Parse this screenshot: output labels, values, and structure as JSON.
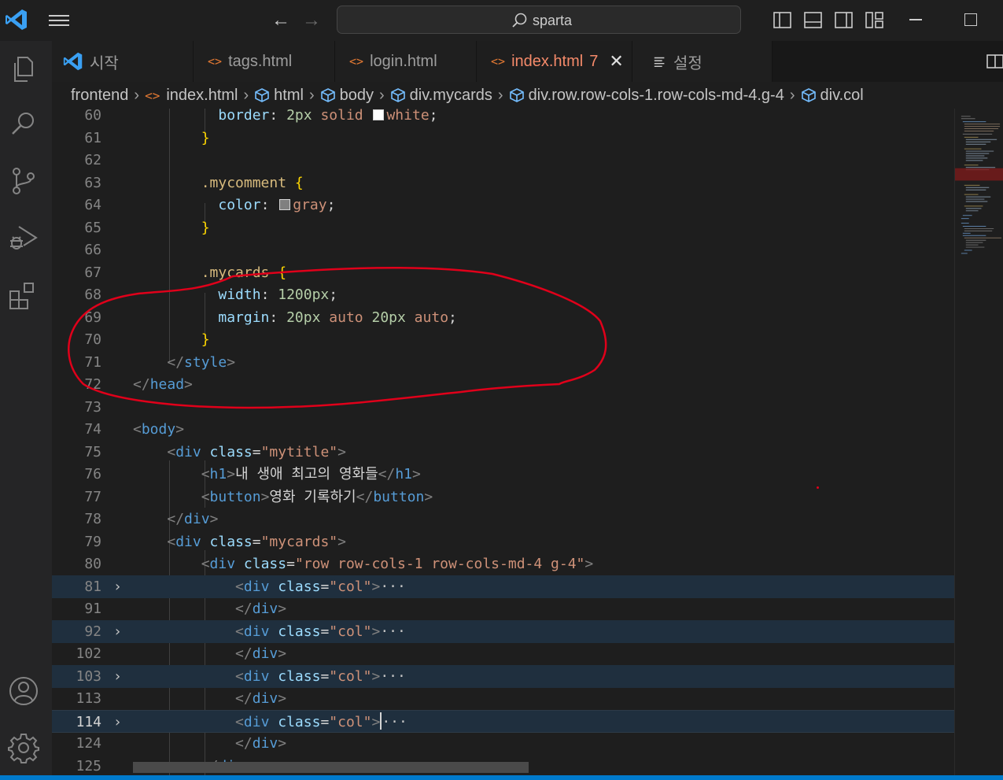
{
  "title_bar": {
    "search_text": "sparta",
    "nav_back": "←",
    "nav_forward": "→"
  },
  "activity_bar": {
    "icons": [
      "explorer-icon",
      "search-icon",
      "source-control-icon",
      "run-debug-icon",
      "extensions-icon",
      "account-icon",
      "settings-gear-icon"
    ]
  },
  "tabs": [
    {
      "label": "시작",
      "icon": "vscode-logo-icon"
    },
    {
      "label": "tags.html",
      "icon": "html-icon"
    },
    {
      "label": "login.html",
      "icon": "html-icon"
    },
    {
      "label": "index.html",
      "icon": "html-icon",
      "problems": "7",
      "close": "✕",
      "active": true
    },
    {
      "label": "설정",
      "icon": "settings-list-icon"
    }
  ],
  "breadcrumb": [
    "frontend",
    "index.html",
    "html",
    "body",
    "div.mycards",
    "div.row.row-cols-1.row-cols-md-4.g-4",
    "div.col"
  ],
  "editor": {
    "line_numbers": [
      "60",
      "61",
      "62",
      "63",
      "64",
      "65",
      "66",
      "67",
      "68",
      "69",
      "70",
      "71",
      "72",
      "73",
      "74",
      "75",
      "76",
      "77",
      "78",
      "79",
      "80",
      "81",
      "91",
      "92",
      "102",
      "103",
      "113",
      "114",
      "124",
      "125"
    ],
    "current_line": "114",
    "code": {
      "l60_prop": "border",
      "l60_colon": ": ",
      "l60_num": "2px",
      "l60_val": " solid ",
      "l60_color": "white",
      "l60_end": ";",
      "l61": "}",
      "l63_sel": ".mycomment",
      "l63_brace": " {",
      "l64_prop": "color",
      "l64_colon": ": ",
      "l64_color": "gray",
      "l64_end": ";",
      "l65": "}",
      "l67_sel": ".mycards",
      "l67_brace": " {",
      "l68_prop": "width",
      "l68_colon": ": ",
      "l68_num": "1200px",
      "l68_end": ";",
      "l69_prop": "margin",
      "l69_colon": ": ",
      "l69_num1": "20px",
      "l69_v1": " auto ",
      "l69_num2": "20px",
      "l69_v2": " auto",
      "l69_end": ";",
      "l70": "}",
      "l71_open": "</",
      "l71_tag": "style",
      "l71_close": ">",
      "l72_open": "</",
      "l72_tag": "head",
      "l72_close": ">",
      "l74_open": "<",
      "l74_tag": "body",
      "l74_close": ">",
      "l75_open": "<",
      "l75_tag": "div",
      "l75_attr": " class",
      "l75_eq": "=",
      "l75_str": "\"mytitle\"",
      "l75_close": ">",
      "l76_open": "<",
      "l76_tag": "h1",
      "l76_close": ">",
      "l76_text": "내 생애 최고의 영화들",
      "l76_etag_open": "</",
      "l76_etag": "h1",
      "l76_etag_close": ">",
      "l77_open": "<",
      "l77_tag": "button",
      "l77_close": ">",
      "l77_text": "영화 기록하기",
      "l77_etag_open": "</",
      "l77_etag": "button",
      "l77_etag_close": ">",
      "l78_open": "</",
      "l78_tag": "div",
      "l78_close": ">",
      "l79_open": "<",
      "l79_tag": "div",
      "l79_attr": " class",
      "l79_eq": "=",
      "l79_str": "\"mycards\"",
      "l79_close": ">",
      "l80_open": "<",
      "l80_tag": "div",
      "l80_attr": " class",
      "l80_eq": "=",
      "l80_str": "\"row row-cols-1 row-cols-md-4 g-4\"",
      "l80_close": ">",
      "col_open": "<",
      "col_tag": "div",
      "col_attr": " class",
      "col_eq": "=",
      "col_str": "\"col\"",
      "col_close": ">",
      "col_ellipsis": "···",
      "div_close_open": "</",
      "div_close_tag": "div",
      "div_close_close": ">"
    }
  },
  "colors": {
    "annotation_stroke": "#e0001a",
    "status_bar": "#007acc",
    "active_tab_text": "#f58a6a"
  }
}
